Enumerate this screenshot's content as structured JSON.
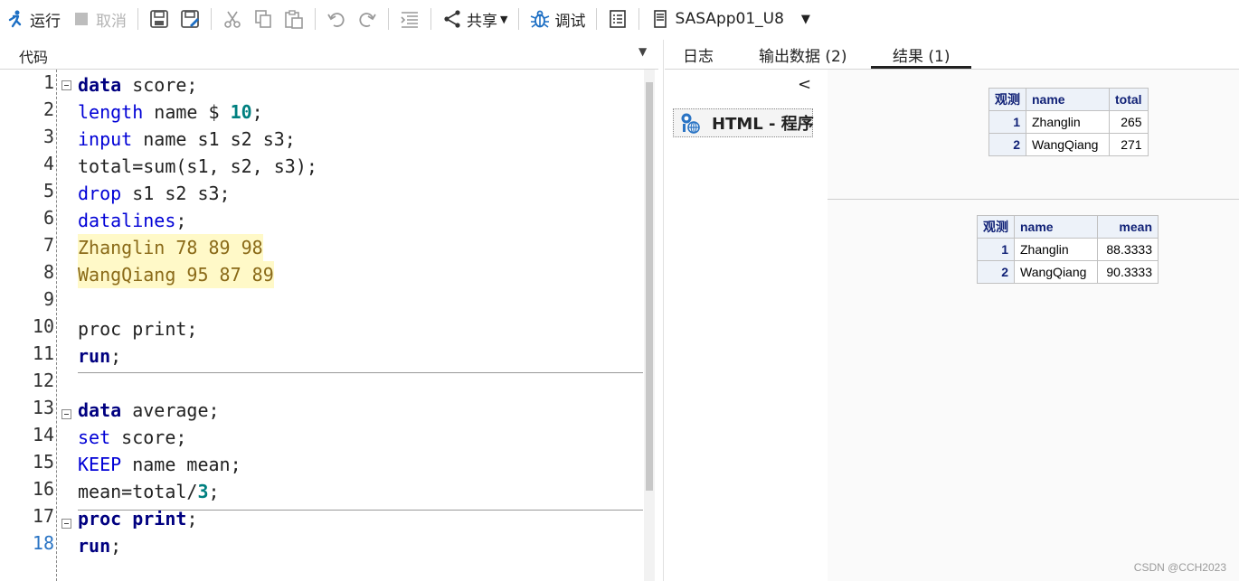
{
  "toolbar": {
    "run_label": "运行",
    "cancel_label": "取消",
    "share_label": "共享",
    "debug_label": "调试",
    "server_label": "SASApp01_U8"
  },
  "code_panel": {
    "title": "代码"
  },
  "editor": {
    "line_numbers": [
      "1",
      "2",
      "3",
      "4",
      "5",
      "6",
      "7",
      "8",
      "9",
      "10",
      "11",
      "12",
      "13",
      "14",
      "15",
      "16",
      "17",
      "18"
    ],
    "lines": {
      "l1_kw": "data",
      "l1_rest": " score;",
      "l2_st": "length",
      "l2_rest": " name $ ",
      "l2_num": "10",
      "l2_end": ";",
      "l3_st": "input",
      "l3_rest": " name s1 s2 s3;",
      "l4": "total=sum(s1, s2, s3);",
      "l5_st": "drop",
      "l5_rest": " s1 s2 s3;",
      "l6_st": "datalines",
      "l6_end": ";",
      "l7": "Zhanglin 78 89 98",
      "l8": "WangQiang 95 87 89",
      "l10": "proc print;",
      "l11_kw": "run",
      "l11_end": ";",
      "l13_kw": "data",
      "l13_rest": " average;",
      "l14_st": "set",
      "l14_rest": " score;",
      "l15_st": "KEEP",
      "l15_rest": " name mean;",
      "l16": "mean=total/",
      "l16_num": "3",
      "l16_end": ";",
      "l17_kw1": "proc",
      "l17_sp": " ",
      "l17_kw2": "print",
      "l17_end": ";",
      "l18_kw": "run",
      "l18_end": ";"
    }
  },
  "tabs": [
    {
      "label": "日志"
    },
    {
      "label": "输出数据 (2)"
    },
    {
      "label": "结果 (1)"
    }
  ],
  "result_nav": {
    "item_label": "HTML - 程序"
  },
  "table1": {
    "headers": [
      "观测",
      "name",
      "total"
    ],
    "rows": [
      {
        "obs": "1",
        "name": "Zhanglin",
        "value": "265"
      },
      {
        "obs": "2",
        "name": "WangQiang",
        "value": "271"
      }
    ]
  },
  "table2": {
    "headers": [
      "观测",
      "name",
      "mean"
    ],
    "rows": [
      {
        "obs": "1",
        "name": "Zhanglin",
        "value": "88.3333"
      },
      {
        "obs": "2",
        "name": "WangQiang",
        "value": "90.3333"
      }
    ]
  },
  "watermark": "CSDN @CCH2023"
}
